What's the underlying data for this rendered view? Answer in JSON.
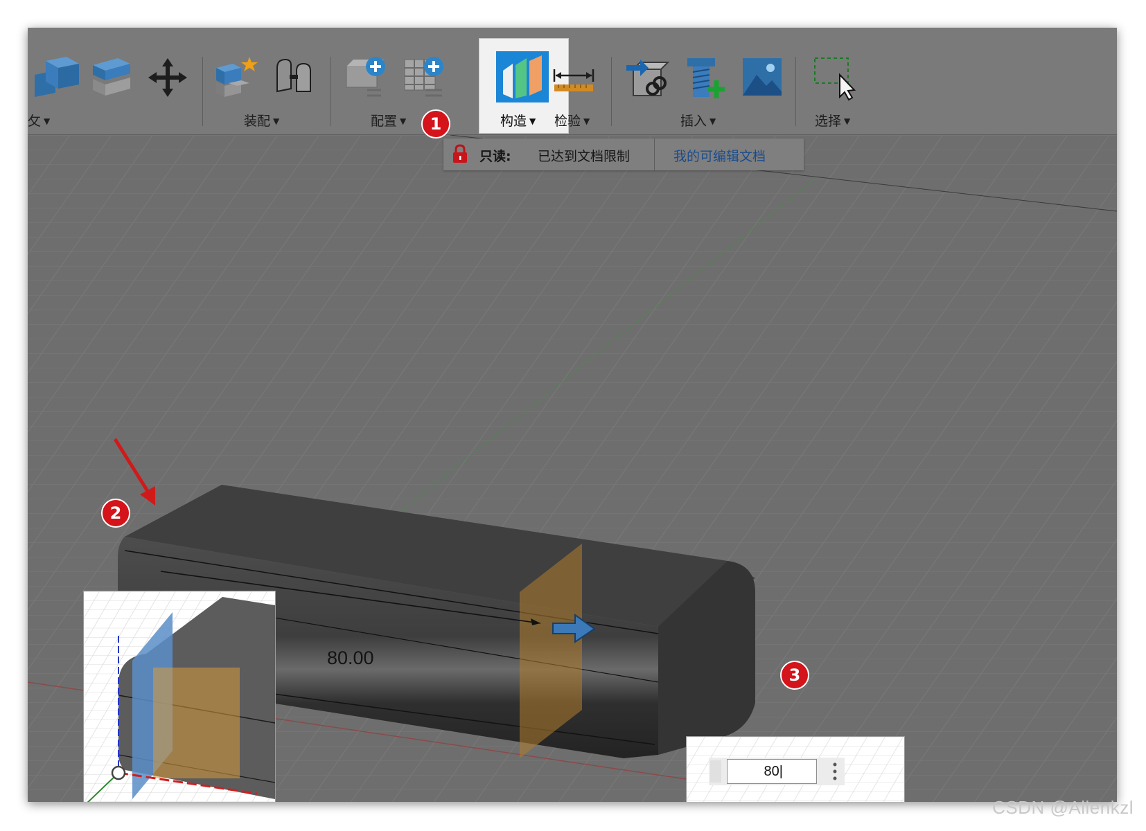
{
  "toolbar": {
    "groups": [
      {
        "label": "装配",
        "icon": "assembly-icon"
      },
      {
        "label": "配置",
        "icon": "configure-icon"
      },
      {
        "label": "构造",
        "icon": "construct-plane-icon",
        "active": true
      },
      {
        "label": "检验",
        "icon": "measure-icon"
      },
      {
        "label": "插入",
        "icon": "insert-icon"
      },
      {
        "label": "选择",
        "icon": "select-window-icon"
      }
    ],
    "cut_label": "攵"
  },
  "readonly": {
    "prefix": "只读:",
    "message": "已达到文档限制",
    "link": "我的可编辑文档"
  },
  "dimension": {
    "label": "80.00",
    "input_value": "80"
  },
  "callouts": [
    "1",
    "2",
    "3"
  ],
  "watermark": "CSDN @Allenkzl",
  "colors": {
    "accent_blue": "#1b86d6",
    "callout_red": "#d4131a",
    "link_blue": "#1a4c8c"
  }
}
